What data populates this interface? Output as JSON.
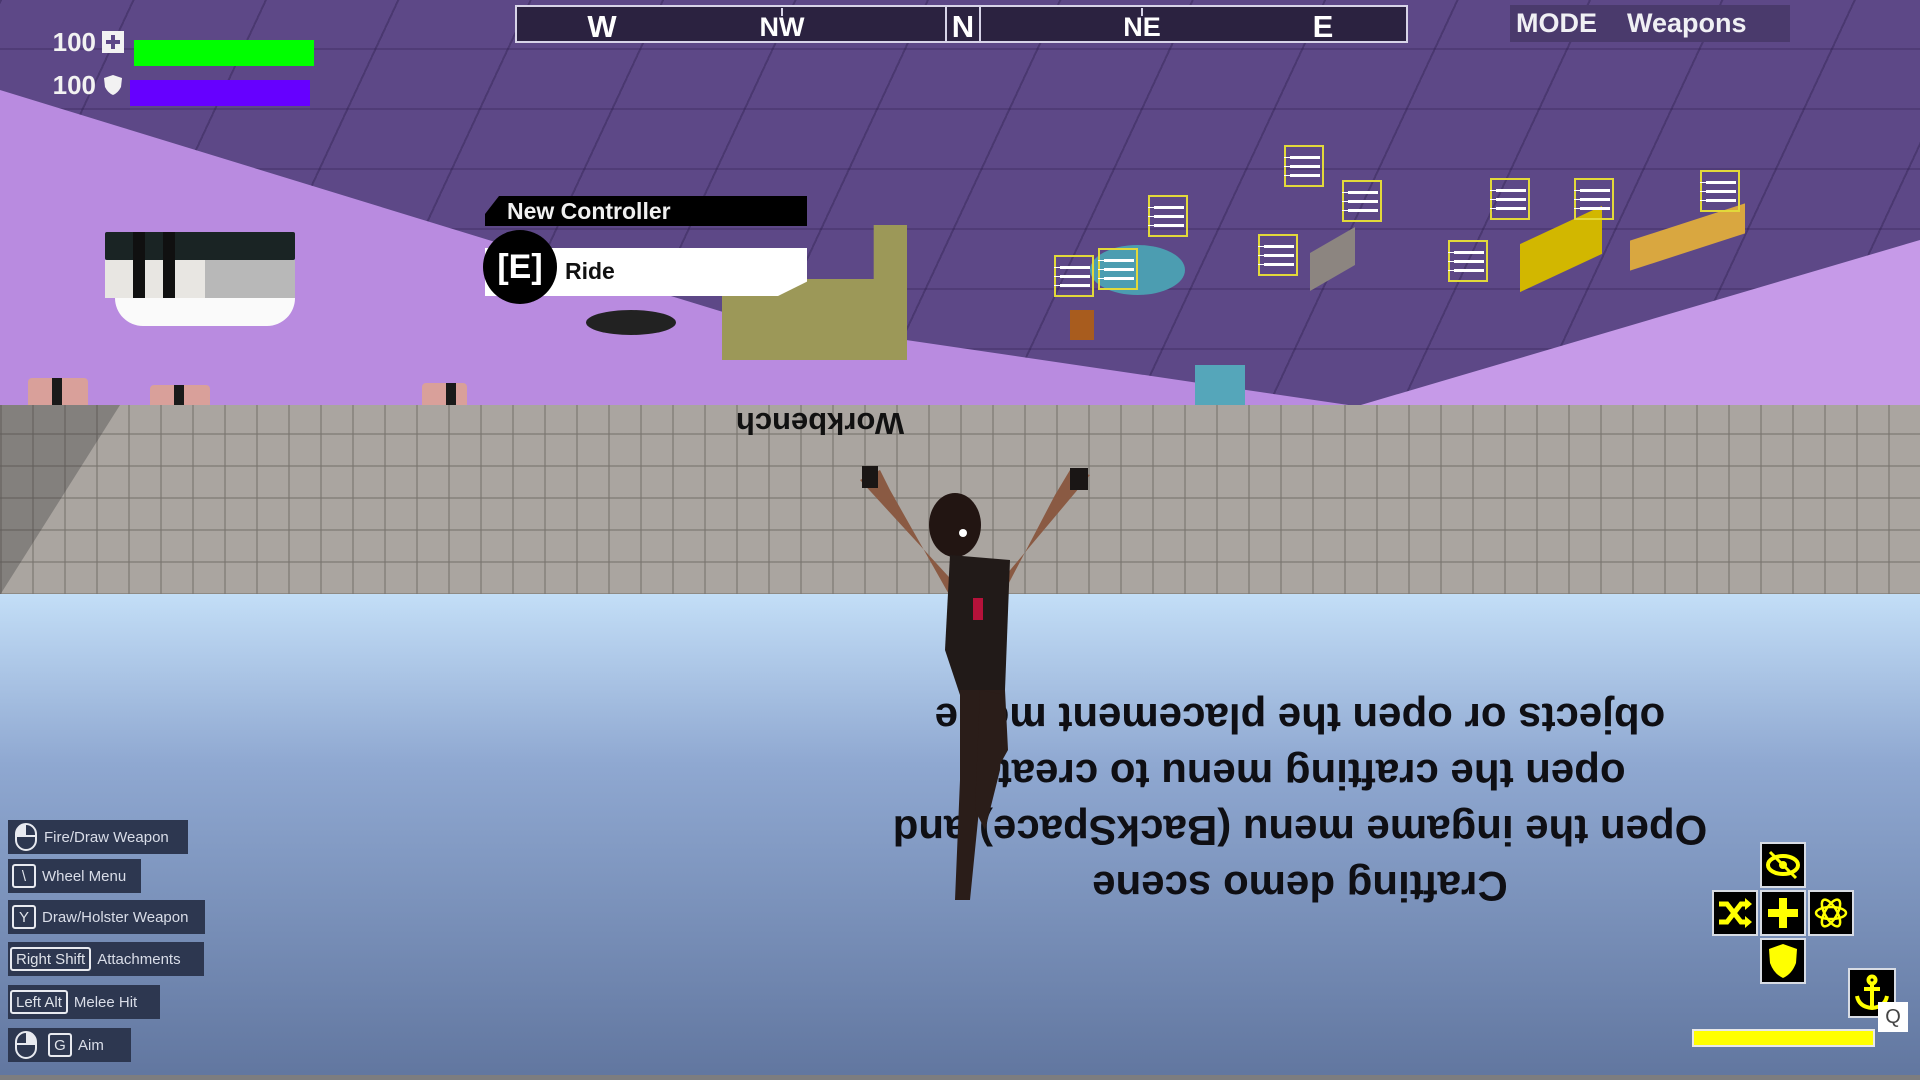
{
  "hud": {
    "health": {
      "value": "100",
      "fraction": 1.0,
      "icon": "medkit-icon",
      "color": "#00ff00"
    },
    "shield": {
      "value": "100",
      "fraction": 1.0,
      "icon": "shield-icon",
      "color": "#6600ff"
    }
  },
  "compass": {
    "headings": [
      "W",
      "NW",
      "N",
      "NE",
      "E"
    ]
  },
  "mode": {
    "label": "MODE",
    "value": "Weapons"
  },
  "prompt": {
    "title": "New Controller",
    "key": "[E]",
    "action": "Ride"
  },
  "world": {
    "workbench_label": "Workbench",
    "floor_text": [
      "Crafting demo scene",
      "Open the ingame menu (BackSpace) and",
      "open the crafting menu to create",
      "objects or open the placement mode"
    ]
  },
  "controls": [
    {
      "key": "mouse-left",
      "label": "Fire/Draw Weapon"
    },
    {
      "key": "\\",
      "label": "Wheel Menu"
    },
    {
      "key": "Y",
      "label": "Draw/Holster Weapon"
    },
    {
      "key": "Right Shift",
      "label": "Attachments"
    },
    {
      "key": "Left Alt",
      "label": "Melee Hit"
    },
    {
      "key": "G",
      "label": "Aim",
      "extra": "mouse-right"
    }
  ],
  "abilities": {
    "top": "eye-off-icon",
    "left": "shuffle-icon",
    "center": "plus-icon",
    "right": "atom-icon",
    "bottom": "shield-icon",
    "anchor": "anchor-icon",
    "anchor_key": "Q",
    "accent_color": "#ffff00"
  },
  "stamina": {
    "fraction": 1.0,
    "color": "#ffff00"
  }
}
